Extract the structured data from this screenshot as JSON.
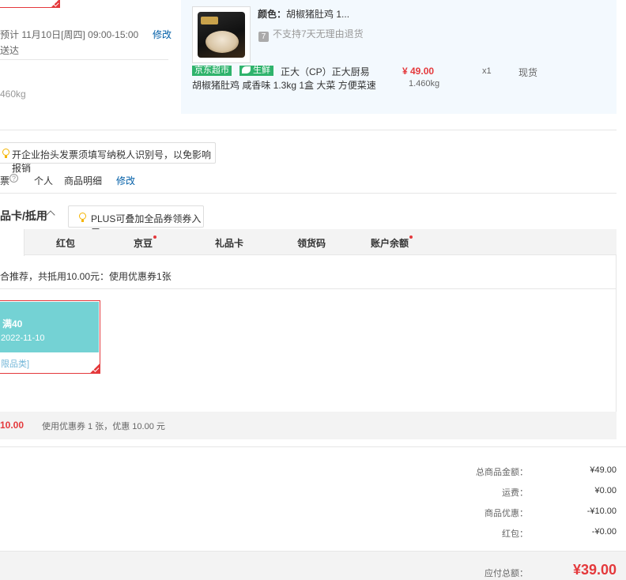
{
  "delivery": {
    "estimate_text": "预计 11月10日[周四] 09:00-15:00 送达",
    "edit_label": "修改",
    "weight_left": "460kg"
  },
  "product": {
    "color_label_key": "颜色：",
    "color_label_val": "胡椒猪肚鸡 1...",
    "no_refund_icon": "7",
    "no_refund": "不支持7天无理由退货",
    "tag_jd": "京东超市",
    "tag_fresh": "生鲜",
    "name_line1": "正大（CP）正大厨易",
    "name_line2": "胡椒猪肚鸡 咸香味 1.3kg 1盒 大菜 方便菜速",
    "price": "¥ 49.00",
    "weight": "1.460kg",
    "qty": "x1",
    "stock": "现货"
  },
  "invoice": {
    "tip": "开企业抬头发票须填写纳税人识别号，以免影响报销",
    "label": "票",
    "help_icon": "?",
    "type": "个人",
    "detail": "商品明细",
    "edit_label": "修改"
  },
  "coupon": {
    "title": "品卡/抵用",
    "plus_tip": "PLUS可叠加全品券领券入口",
    "tabs": [
      "红包",
      "京豆",
      "礼品卡",
      "领货码",
      "账户余额"
    ],
    "recommend": "合推荐，共抵用10.00元：使用优惠券1张",
    "card": {
      "amount": "满40",
      "date": "2022-11-10",
      "category": "限品类]"
    },
    "summary_amount": "10.00",
    "summary_text": "使用优惠券 1 张，优惠 10.00 元"
  },
  "totals": {
    "rows": [
      {
        "label": "总商品金额：",
        "value": "¥49.00"
      },
      {
        "label": "运费：",
        "value": "¥0.00"
      },
      {
        "label": "商品优惠：",
        "value": "-¥10.00"
      },
      {
        "label": "红包：",
        "value": "-¥0.00"
      }
    ],
    "payable_label": "应付总额：",
    "payable_value": "¥39.00"
  },
  "colors": {
    "accent_red": "#e4393c",
    "link_blue": "#005ea7",
    "fresh_green": "#2fb36c",
    "coupon_teal": "#74d2d4"
  }
}
